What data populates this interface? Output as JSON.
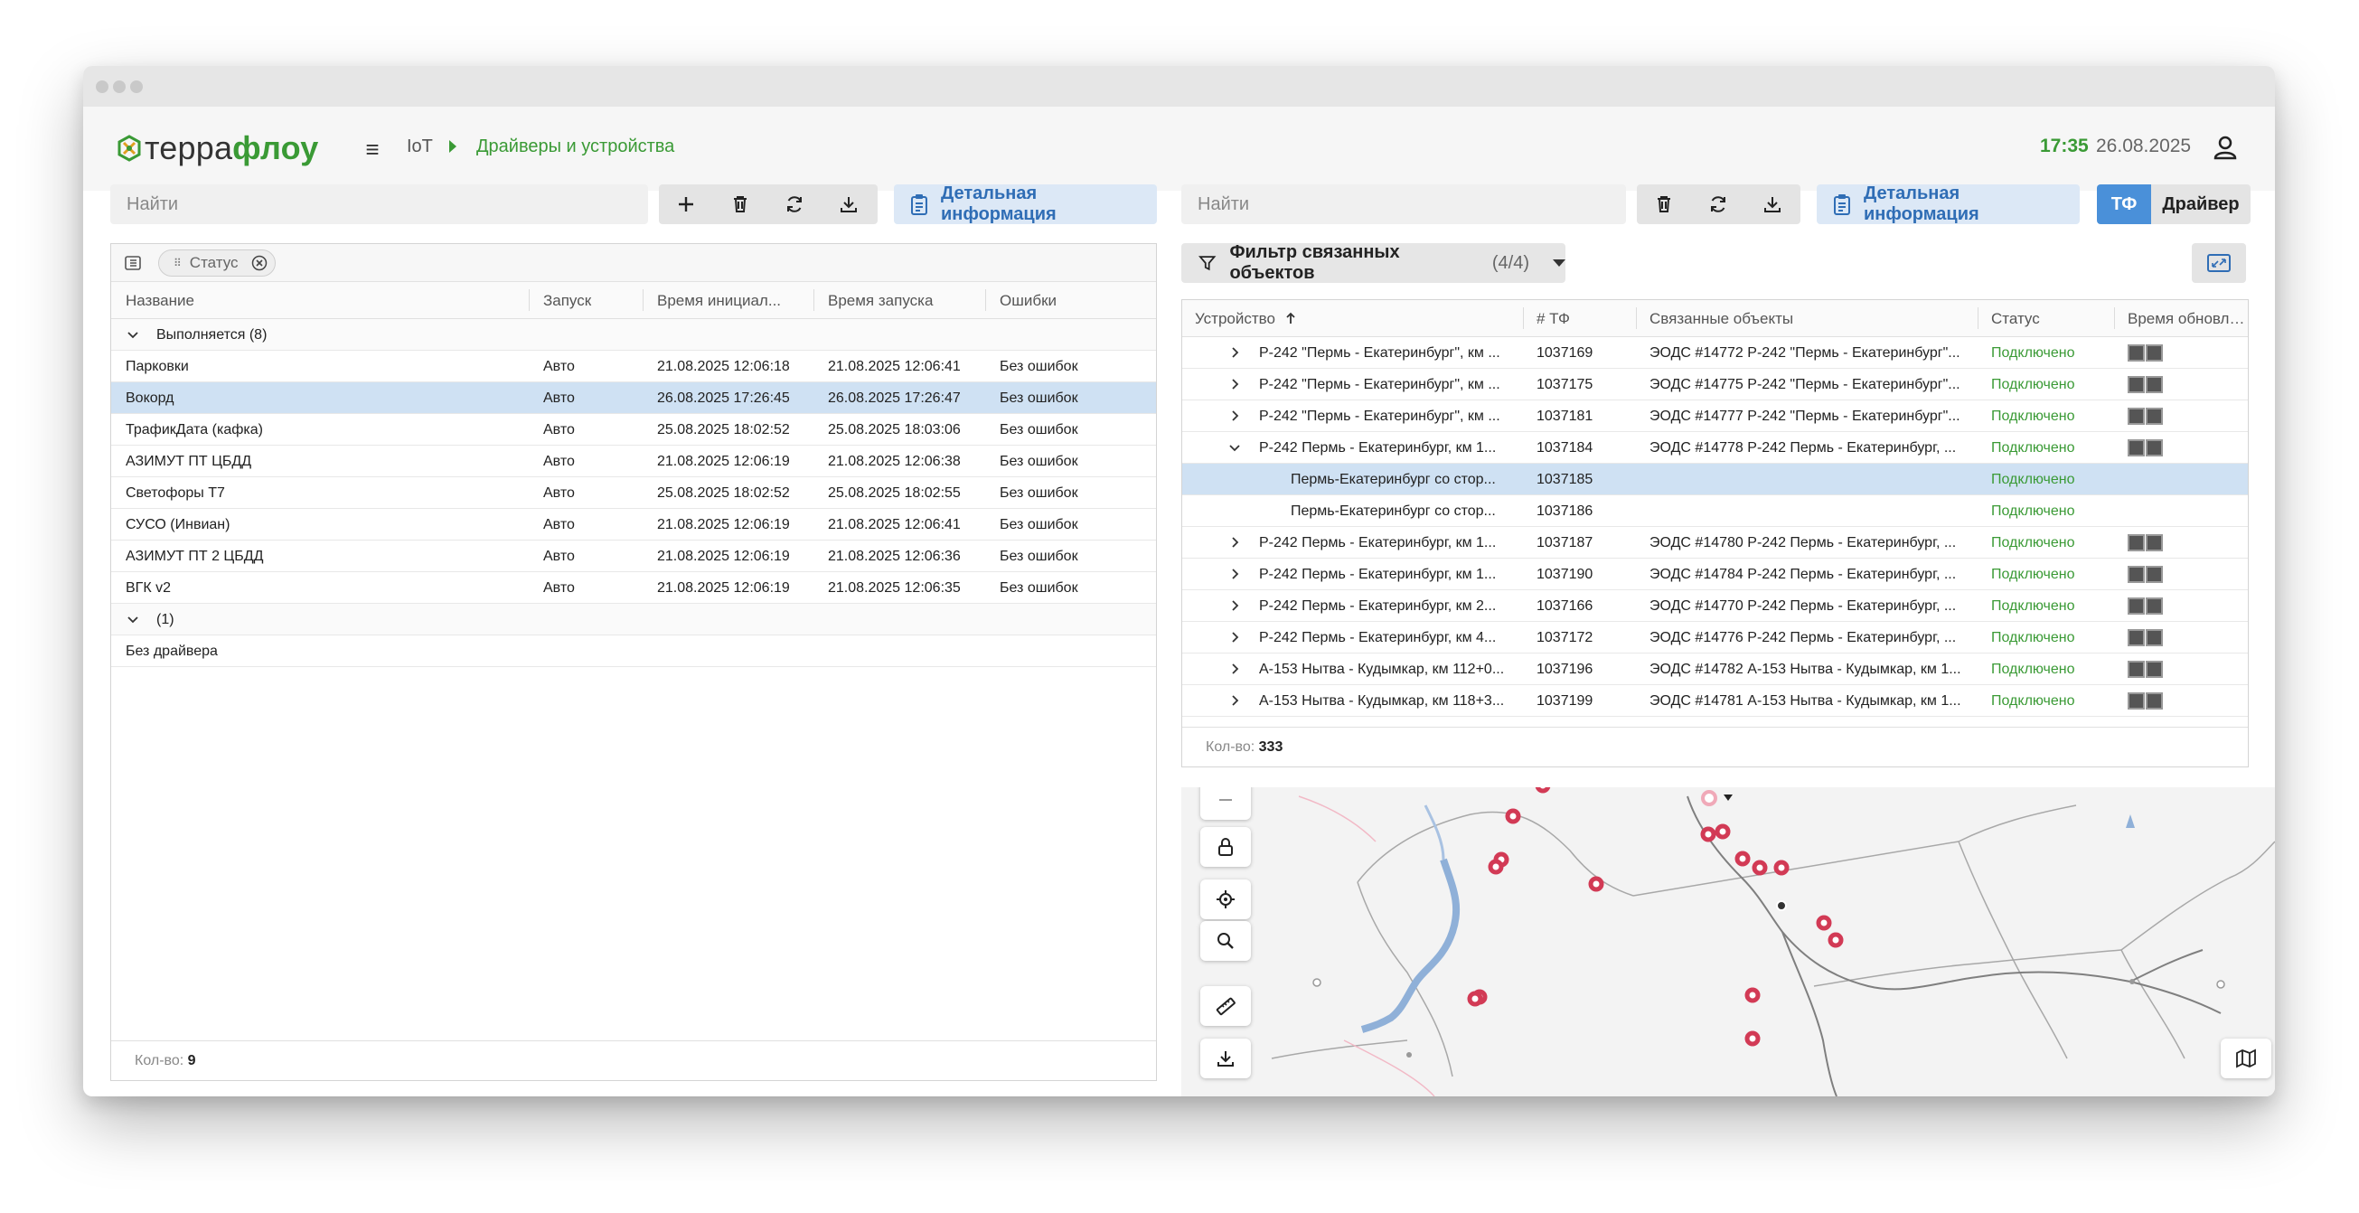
{
  "app": {
    "logo_part1": "терра",
    "logo_part2": "флоу"
  },
  "header": {
    "breadcrumb_root": "IoT",
    "breadcrumb_current": "Драйверы и устройства",
    "time": "17:35",
    "date": "26.08.2025"
  },
  "left": {
    "search_placeholder": "Найти",
    "detail_label": "Детальная информация",
    "chip_label": "Статус",
    "columns": [
      "Название",
      "Запуск",
      "Время инициал...",
      "Время запуска",
      "Ошибки"
    ],
    "group1_label": "Выполняется (8)",
    "rows": [
      {
        "name": "Парковки",
        "launch": "Авто",
        "init": "21.08.2025 12:06:18",
        "start": "21.08.2025 12:06:41",
        "errors": "Без ошибок"
      },
      {
        "name": "Вокорд",
        "launch": "Авто",
        "init": "26.08.2025 17:26:45",
        "start": "26.08.2025 17:26:47",
        "errors": "Без ошибок"
      },
      {
        "name": "ТрафикДата (кафка)",
        "launch": "Авто",
        "init": "25.08.2025 18:02:52",
        "start": "25.08.2025 18:03:06",
        "errors": "Без ошибок"
      },
      {
        "name": "АЗИМУТ ПТ ЦБДД",
        "launch": "Авто",
        "init": "21.08.2025 12:06:19",
        "start": "21.08.2025 12:06:38",
        "errors": "Без ошибок"
      },
      {
        "name": "Светофоры Т7",
        "launch": "Авто",
        "init": "25.08.2025 18:02:52",
        "start": "25.08.2025 18:02:55",
        "errors": "Без ошибок"
      },
      {
        "name": "СУСО (Инвиан)",
        "launch": "Авто",
        "init": "21.08.2025 12:06:19",
        "start": "21.08.2025 12:06:41",
        "errors": "Без ошибок"
      },
      {
        "name": "АЗИМУТ ПТ 2 ЦБДД",
        "launch": "Авто",
        "init": "21.08.2025 12:06:19",
        "start": "21.08.2025 12:06:36",
        "errors": "Без ошибок"
      },
      {
        "name": "ВГК v2",
        "launch": "Авто",
        "init": "21.08.2025 12:06:19",
        "start": "21.08.2025 12:06:35",
        "errors": "Без ошибок"
      }
    ],
    "group2_label": "(1)",
    "group2_row": "Без драйвера",
    "count_label": "Кол-во:",
    "count_value": "9"
  },
  "right": {
    "search_placeholder": "Найти",
    "detail_label": "Детальная информация",
    "toggle_a": "ТФ",
    "toggle_b": "Драйвер",
    "filter_label": "Фильтр связанных объектов",
    "filter_count": "(4/4)",
    "columns": [
      "Устройство",
      "# ТФ",
      "Связанные объекты",
      "Статус",
      "Время обновле..."
    ],
    "rows": [
      {
        "device": "Р-242 \"Пермь - Екатеринбург\", км ...",
        "tf": "1037169",
        "linked": "ЭОДС #14772 Р-242 \"Пермь - Екатеринбург\"...",
        "status": "Подключено"
      },
      {
        "device": "Р-242 \"Пермь - Екатеринбург\", км ...",
        "tf": "1037175",
        "linked": "ЭОДС #14775 Р-242 \"Пермь - Екатеринбург\"...",
        "status": "Подключено"
      },
      {
        "device": "Р-242 \"Пермь - Екатеринбург\", км ...",
        "tf": "1037181",
        "linked": "ЭОДС #14777 Р-242 \"Пермь - Екатеринбург\"...",
        "status": "Подключено"
      },
      {
        "device": "Р-242 Пермь - Екатеринбург, км 1...",
        "tf": "1037184",
        "linked": "ЭОДС #14778 Р-242 Пермь - Екатеринбург, ...",
        "status": "Подключено"
      },
      {
        "device": "Пермь-Екатеринбург со стор...",
        "tf": "1037185",
        "linked": "",
        "status": "Подключено"
      },
      {
        "device": "Пермь-Екатеринбург со стор...",
        "tf": "1037186",
        "linked": "",
        "status": "Подключено"
      },
      {
        "device": "Р-242 Пермь - Екатеринбург, км 1...",
        "tf": "1037187",
        "linked": "ЭОДС #14780 Р-242 Пермь - Екатеринбург, ...",
        "status": "Подключено"
      },
      {
        "device": "Р-242 Пермь - Екатеринбург, км 1...",
        "tf": "1037190",
        "linked": "ЭОДС #14784 Р-242 Пермь - Екатеринбург, ...",
        "status": "Подключено"
      },
      {
        "device": "Р-242 Пермь - Екатеринбург, км 2...",
        "tf": "1037166",
        "linked": "ЭОДС #14770 Р-242 Пермь - Екатеринбург, ...",
        "status": "Подключено"
      },
      {
        "device": "Р-242 Пермь - Екатеринбург, км 4...",
        "tf": "1037172",
        "linked": "ЭОДС #14776 Р-242 Пермь - Екатеринбург, ...",
        "status": "Подключено"
      },
      {
        "device": "А-153 Нытва - Кудымкар, км 112+0...",
        "tf": "1037196",
        "linked": "ЭОДС #14782 А-153 Нытва - Кудымкар, км 1...",
        "status": "Подключено"
      },
      {
        "device": "А-153 Нытва - Кудымкар, км 118+3...",
        "tf": "1037199",
        "linked": "ЭОДС #14781 А-153 Нытва - Кудымкар, км 1...",
        "status": "Подключено"
      }
    ],
    "count_label": "Кол-во:",
    "count_value": "333"
  },
  "colors": {
    "brand_green": "#3a9a35",
    "accent_blue": "#4a90d9",
    "selection": "#cfe1f3",
    "marker": "#d23a55"
  }
}
